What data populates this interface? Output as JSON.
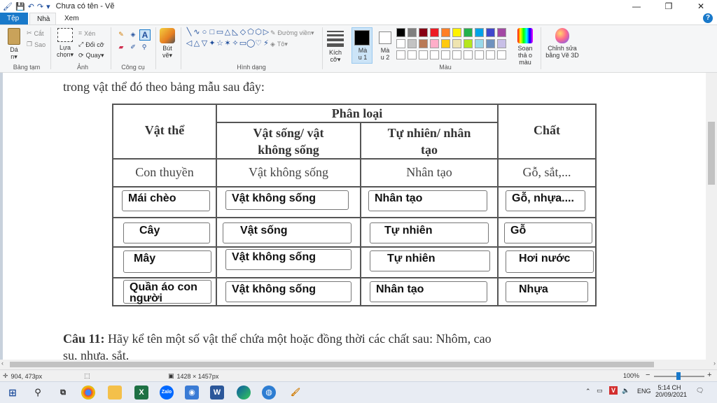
{
  "window": {
    "title": "Chưa có tên - Vẽ",
    "min": "—",
    "max": "❐",
    "close": "✕"
  },
  "tabs": {
    "file": "Tệp",
    "home": "Nhà",
    "view": "Xem"
  },
  "ribbon": {
    "clipboard": {
      "paste": "Dá n▾",
      "cut": "Cắt",
      "copy": "Sao",
      "label": "Bảng tạm"
    },
    "image": {
      "select": "Lựa chọn▾",
      "crop": "Xén",
      "resize": "Đổi cỡ",
      "rotate": "Quay▾",
      "label": "Ảnh"
    },
    "tools": {
      "label": "Công cụ"
    },
    "brushes": {
      "label": "Bút vẽ▾"
    },
    "shapes": {
      "outline": "Đường viền▾",
      "fill": "Tô▾",
      "label": "Hình dạng"
    },
    "size": {
      "label": "Kích cỡ▾"
    },
    "color1": {
      "label": "Mà u 1"
    },
    "color2": {
      "label": "Mà u 2"
    },
    "colors": {
      "label": "Màu",
      "row1": [
        "#000000",
        "#7f7f7f",
        "#880015",
        "#ed1c24",
        "#ff7f27",
        "#fff200",
        "#22b14c",
        "#00a2e8",
        "#3f48cc",
        "#a349a4"
      ],
      "row2": [
        "#ffffff",
        "#c3c3c3",
        "#b97a57",
        "#ffaec9",
        "#ffc90e",
        "#efe4b0",
        "#b5e61d",
        "#99d9ea",
        "#7092be",
        "#c8bfe7"
      ]
    },
    "edit_colors": {
      "label": "Soạn thả o màu"
    },
    "paint3d": {
      "label": "Chỉnh sửa bằng Vẽ 3D"
    }
  },
  "document": {
    "intro": "trong vật thể đó theo bảng mẫu sau đây:",
    "headers": {
      "object": "Vật thể",
      "classification": "Phân loại",
      "living": "Vật sống/ vật\nkhông sống",
      "natural": "Tự nhiên/ nhân\ntạo",
      "substance": "Chất"
    },
    "example": {
      "object": "Con thuyền",
      "living": "Vật không sống",
      "natural": "Nhân tạo",
      "substance": "Gỗ, sắt,..."
    },
    "rows": [
      {
        "object": "Mái chèo",
        "living": "Vật không sống",
        "natural": "Nhân tạo",
        "substance": "Gỗ, nhựa...."
      },
      {
        "object": "Cây",
        "living": "Vật sống",
        "natural": "Tự nhiên",
        "substance": "Gỗ"
      },
      {
        "object": "Mây",
        "living": "Vật không sống",
        "natural": "Tự nhiên",
        "substance": "Hơi nước"
      },
      {
        "object": "Quần áo con\nngười",
        "living": "Vật không sống",
        "natural": "Nhân tạo",
        "substance": "Nhựa"
      }
    ],
    "question_label": "Câu 11:",
    "question_text": "Hãy kể tên một số vật thể chứa một hoặc đồng thời các chất sau: Nhôm, cao",
    "question_cont": "su, nhựa, sắt."
  },
  "status": {
    "position": "904, 473px",
    "size": "1428 × 1457px",
    "zoom": "100%"
  },
  "taskbar": {
    "lang": "ENG",
    "time": "5:14 CH",
    "date": "20/09/2021"
  }
}
